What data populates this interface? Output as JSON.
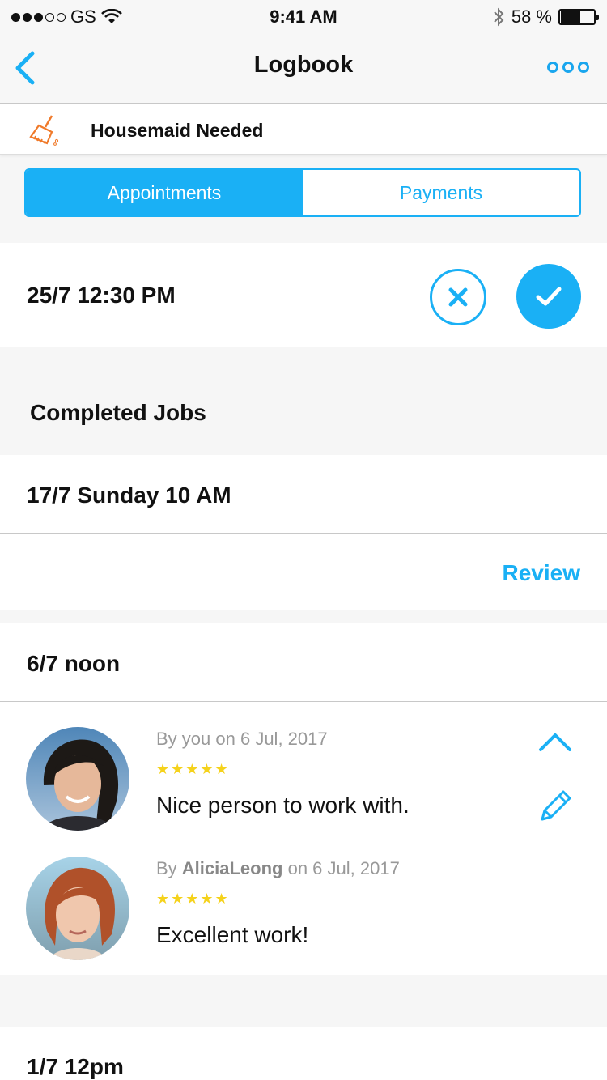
{
  "status_bar": {
    "carrier": "GS",
    "time": "9:41 AM",
    "battery": "58 %",
    "battery_level": 0.58
  },
  "nav": {
    "title": "Logbook"
  },
  "job": {
    "title": "Housemaid Needed",
    "icon": "broom-icon"
  },
  "tabs": [
    {
      "label": "Appointments",
      "active": true
    },
    {
      "label": "Payments",
      "active": false
    }
  ],
  "appointment": {
    "time": "25/7 12:30 PM"
  },
  "completed": {
    "title": "Completed Jobs",
    "jobs": [
      {
        "date": "17/7 Sunday 10 AM",
        "review_label": "Review"
      },
      {
        "date": "6/7 noon",
        "reviews": [
          {
            "by_prefix": "By ",
            "author": "you",
            "on_text": " on 6 Jul, 2017",
            "stars": "★★★★★",
            "rating": 5,
            "text": "Nice person to work with."
          },
          {
            "by_prefix": "By ",
            "author": "AliciaLeong",
            "on_text": " on 6 Jul, 2017",
            "stars": "★★★★★",
            "rating": 5,
            "text": "Excellent work!"
          }
        ]
      },
      {
        "date": "1/7 12pm"
      }
    ]
  },
  "colors": {
    "accent": "#1ab0f5",
    "star": "#f5d21b",
    "icon_orange": "#f07a2a"
  }
}
